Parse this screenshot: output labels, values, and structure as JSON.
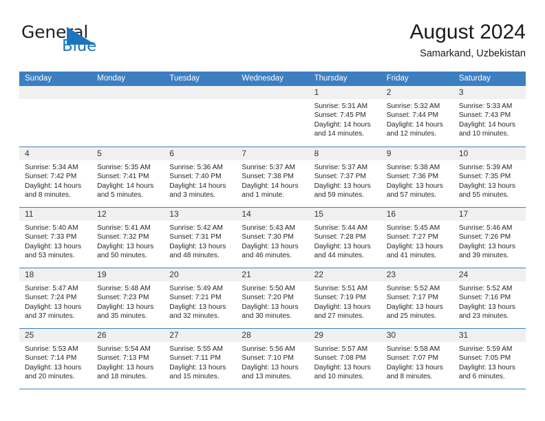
{
  "brand": {
    "word_one": "General",
    "word_two": "Blue",
    "triangle_icon": "triangle-icon",
    "color_dark": "#231f20",
    "color_blue": "#1b76bd"
  },
  "header": {
    "title": "August 2024",
    "subtitle": "Samarkand, Uzbekistan"
  },
  "theme": {
    "header_blue": "#3c7fc1",
    "day_band_gray": "#f0f0f0"
  },
  "weekday_headers": [
    "Sunday",
    "Monday",
    "Tuesday",
    "Wednesday",
    "Thursday",
    "Friday",
    "Saturday"
  ],
  "weeks": [
    [
      {
        "day": "",
        "empty": true,
        "sunrise": "",
        "sunset": "",
        "daylight_a": "",
        "daylight_b": ""
      },
      {
        "day": "",
        "empty": true,
        "sunrise": "",
        "sunset": "",
        "daylight_a": "",
        "daylight_b": ""
      },
      {
        "day": "",
        "empty": true,
        "sunrise": "",
        "sunset": "",
        "daylight_a": "",
        "daylight_b": ""
      },
      {
        "day": "",
        "empty": true,
        "sunrise": "",
        "sunset": "",
        "daylight_a": "",
        "daylight_b": ""
      },
      {
        "day": "1",
        "empty": false,
        "sunrise": "Sunrise: 5:31 AM",
        "sunset": "Sunset: 7:45 PM",
        "daylight_a": "Daylight: 14 hours",
        "daylight_b": "and 14 minutes."
      },
      {
        "day": "2",
        "empty": false,
        "sunrise": "Sunrise: 5:32 AM",
        "sunset": "Sunset: 7:44 PM",
        "daylight_a": "Daylight: 14 hours",
        "daylight_b": "and 12 minutes."
      },
      {
        "day": "3",
        "empty": false,
        "sunrise": "Sunrise: 5:33 AM",
        "sunset": "Sunset: 7:43 PM",
        "daylight_a": "Daylight: 14 hours",
        "daylight_b": "and 10 minutes."
      }
    ],
    [
      {
        "day": "4",
        "empty": false,
        "sunrise": "Sunrise: 5:34 AM",
        "sunset": "Sunset: 7:42 PM",
        "daylight_a": "Daylight: 14 hours",
        "daylight_b": "and 8 minutes."
      },
      {
        "day": "5",
        "empty": false,
        "sunrise": "Sunrise: 5:35 AM",
        "sunset": "Sunset: 7:41 PM",
        "daylight_a": "Daylight: 14 hours",
        "daylight_b": "and 5 minutes."
      },
      {
        "day": "6",
        "empty": false,
        "sunrise": "Sunrise: 5:36 AM",
        "sunset": "Sunset: 7:40 PM",
        "daylight_a": "Daylight: 14 hours",
        "daylight_b": "and 3 minutes."
      },
      {
        "day": "7",
        "empty": false,
        "sunrise": "Sunrise: 5:37 AM",
        "sunset": "Sunset: 7:38 PM",
        "daylight_a": "Daylight: 14 hours",
        "daylight_b": "and 1 minute."
      },
      {
        "day": "8",
        "empty": false,
        "sunrise": "Sunrise: 5:37 AM",
        "sunset": "Sunset: 7:37 PM",
        "daylight_a": "Daylight: 13 hours",
        "daylight_b": "and 59 minutes."
      },
      {
        "day": "9",
        "empty": false,
        "sunrise": "Sunrise: 5:38 AM",
        "sunset": "Sunset: 7:36 PM",
        "daylight_a": "Daylight: 13 hours",
        "daylight_b": "and 57 minutes."
      },
      {
        "day": "10",
        "empty": false,
        "sunrise": "Sunrise: 5:39 AM",
        "sunset": "Sunset: 7:35 PM",
        "daylight_a": "Daylight: 13 hours",
        "daylight_b": "and 55 minutes."
      }
    ],
    [
      {
        "day": "11",
        "empty": false,
        "sunrise": "Sunrise: 5:40 AM",
        "sunset": "Sunset: 7:33 PM",
        "daylight_a": "Daylight: 13 hours",
        "daylight_b": "and 53 minutes."
      },
      {
        "day": "12",
        "empty": false,
        "sunrise": "Sunrise: 5:41 AM",
        "sunset": "Sunset: 7:32 PM",
        "daylight_a": "Daylight: 13 hours",
        "daylight_b": "and 50 minutes."
      },
      {
        "day": "13",
        "empty": false,
        "sunrise": "Sunrise: 5:42 AM",
        "sunset": "Sunset: 7:31 PM",
        "daylight_a": "Daylight: 13 hours",
        "daylight_b": "and 48 minutes."
      },
      {
        "day": "14",
        "empty": false,
        "sunrise": "Sunrise: 5:43 AM",
        "sunset": "Sunset: 7:30 PM",
        "daylight_a": "Daylight: 13 hours",
        "daylight_b": "and 46 minutes."
      },
      {
        "day": "15",
        "empty": false,
        "sunrise": "Sunrise: 5:44 AM",
        "sunset": "Sunset: 7:28 PM",
        "daylight_a": "Daylight: 13 hours",
        "daylight_b": "and 44 minutes."
      },
      {
        "day": "16",
        "empty": false,
        "sunrise": "Sunrise: 5:45 AM",
        "sunset": "Sunset: 7:27 PM",
        "daylight_a": "Daylight: 13 hours",
        "daylight_b": "and 41 minutes."
      },
      {
        "day": "17",
        "empty": false,
        "sunrise": "Sunrise: 5:46 AM",
        "sunset": "Sunset: 7:26 PM",
        "daylight_a": "Daylight: 13 hours",
        "daylight_b": "and 39 minutes."
      }
    ],
    [
      {
        "day": "18",
        "empty": false,
        "sunrise": "Sunrise: 5:47 AM",
        "sunset": "Sunset: 7:24 PM",
        "daylight_a": "Daylight: 13 hours",
        "daylight_b": "and 37 minutes."
      },
      {
        "day": "19",
        "empty": false,
        "sunrise": "Sunrise: 5:48 AM",
        "sunset": "Sunset: 7:23 PM",
        "daylight_a": "Daylight: 13 hours",
        "daylight_b": "and 35 minutes."
      },
      {
        "day": "20",
        "empty": false,
        "sunrise": "Sunrise: 5:49 AM",
        "sunset": "Sunset: 7:21 PM",
        "daylight_a": "Daylight: 13 hours",
        "daylight_b": "and 32 minutes."
      },
      {
        "day": "21",
        "empty": false,
        "sunrise": "Sunrise: 5:50 AM",
        "sunset": "Sunset: 7:20 PM",
        "daylight_a": "Daylight: 13 hours",
        "daylight_b": "and 30 minutes."
      },
      {
        "day": "22",
        "empty": false,
        "sunrise": "Sunrise: 5:51 AM",
        "sunset": "Sunset: 7:19 PM",
        "daylight_a": "Daylight: 13 hours",
        "daylight_b": "and 27 minutes."
      },
      {
        "day": "23",
        "empty": false,
        "sunrise": "Sunrise: 5:52 AM",
        "sunset": "Sunset: 7:17 PM",
        "daylight_a": "Daylight: 13 hours",
        "daylight_b": "and 25 minutes."
      },
      {
        "day": "24",
        "empty": false,
        "sunrise": "Sunrise: 5:52 AM",
        "sunset": "Sunset: 7:16 PM",
        "daylight_a": "Daylight: 13 hours",
        "daylight_b": "and 23 minutes."
      }
    ],
    [
      {
        "day": "25",
        "empty": false,
        "sunrise": "Sunrise: 5:53 AM",
        "sunset": "Sunset: 7:14 PM",
        "daylight_a": "Daylight: 13 hours",
        "daylight_b": "and 20 minutes."
      },
      {
        "day": "26",
        "empty": false,
        "sunrise": "Sunrise: 5:54 AM",
        "sunset": "Sunset: 7:13 PM",
        "daylight_a": "Daylight: 13 hours",
        "daylight_b": "and 18 minutes."
      },
      {
        "day": "27",
        "empty": false,
        "sunrise": "Sunrise: 5:55 AM",
        "sunset": "Sunset: 7:11 PM",
        "daylight_a": "Daylight: 13 hours",
        "daylight_b": "and 15 minutes."
      },
      {
        "day": "28",
        "empty": false,
        "sunrise": "Sunrise: 5:56 AM",
        "sunset": "Sunset: 7:10 PM",
        "daylight_a": "Daylight: 13 hours",
        "daylight_b": "and 13 minutes."
      },
      {
        "day": "29",
        "empty": false,
        "sunrise": "Sunrise: 5:57 AM",
        "sunset": "Sunset: 7:08 PM",
        "daylight_a": "Daylight: 13 hours",
        "daylight_b": "and 10 minutes."
      },
      {
        "day": "30",
        "empty": false,
        "sunrise": "Sunrise: 5:58 AM",
        "sunset": "Sunset: 7:07 PM",
        "daylight_a": "Daylight: 13 hours",
        "daylight_b": "and 8 minutes."
      },
      {
        "day": "31",
        "empty": false,
        "sunrise": "Sunrise: 5:59 AM",
        "sunset": "Sunset: 7:05 PM",
        "daylight_a": "Daylight: 13 hours",
        "daylight_b": "and 6 minutes."
      }
    ]
  ]
}
